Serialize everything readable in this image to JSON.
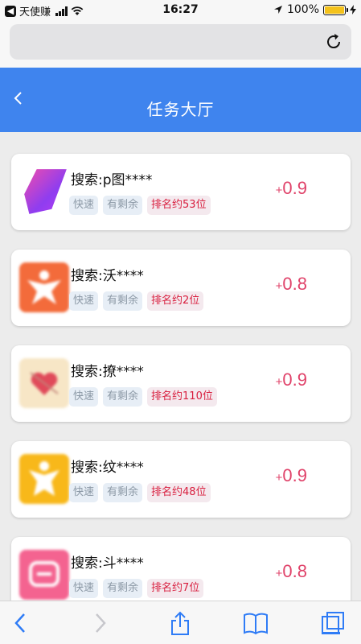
{
  "status_bar": {
    "carrier": "天使赚",
    "time": "16:27",
    "battery": "100%",
    "battery_level": 1.0
  },
  "browser": {
    "url_text": "",
    "reload_icon": "reload-icon"
  },
  "header": {
    "back_icon": "chevron-left-icon",
    "title": "任务大厅"
  },
  "tasks": [
    {
      "name": "搜索:p图****",
      "tags": [
        "快速",
        "有剩余"
      ],
      "rank": "排名约53位",
      "reward_plus": "+",
      "reward_value": "0.9",
      "icon_color": "#8e3df0"
    },
    {
      "name": "搜索:沃****",
      "tags": [
        "快速",
        "有剩余"
      ],
      "rank": "排名约2位",
      "reward_plus": "+",
      "reward_value": "0.8",
      "icon_color": "#f36b3b"
    },
    {
      "name": "搜索:撩****",
      "tags": [
        "快速",
        "有剩余"
      ],
      "rank": "排名约110位",
      "reward_plus": "+",
      "reward_value": "0.9",
      "icon_color": "#f7e6c6"
    },
    {
      "name": "搜索:纹****",
      "tags": [
        "快速",
        "有剩余"
      ],
      "rank": "排名约48位",
      "reward_plus": "+",
      "reward_value": "0.9",
      "icon_color": "#f8b81a"
    },
    {
      "name": "搜索:斗****",
      "tags": [
        "快速",
        "有剩余"
      ],
      "rank": "排名约7位",
      "reward_plus": "+",
      "reward_value": "0.8",
      "icon_color": "#f46390"
    }
  ],
  "toolbar": {
    "back_icon": "chevron-left-icon",
    "forward_icon": "chevron-right-icon",
    "share_icon": "share-icon",
    "bookmarks_icon": "book-icon",
    "tabs_icon": "tabs-icon"
  }
}
